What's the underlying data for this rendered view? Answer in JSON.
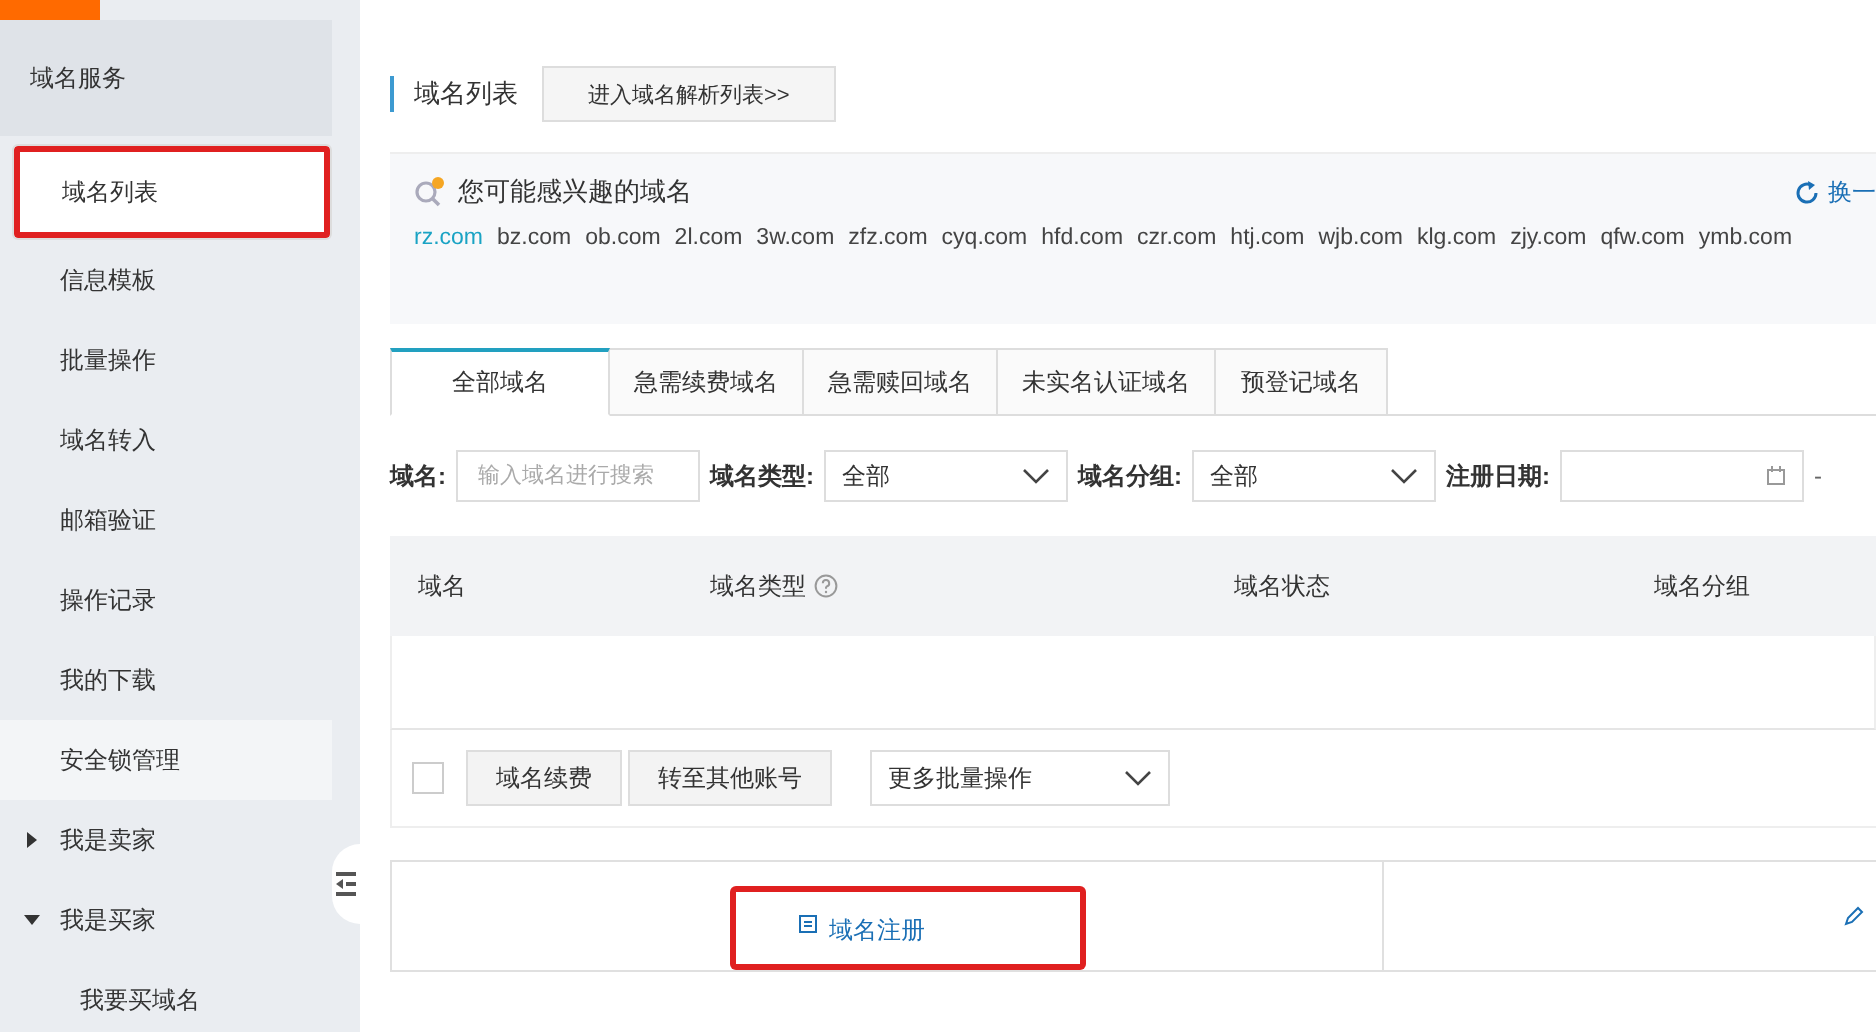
{
  "sidebar": {
    "title": "域名服务",
    "items": [
      {
        "label": "域名列表",
        "kind": "item",
        "selected": true,
        "highlighted": true
      },
      {
        "label": "信息模板",
        "kind": "item",
        "selected": false,
        "highlighted": false
      },
      {
        "label": "批量操作",
        "kind": "item",
        "selected": false,
        "highlighted": false
      },
      {
        "label": "域名转入",
        "kind": "item",
        "selected": false,
        "highlighted": false
      },
      {
        "label": "邮箱验证",
        "kind": "item",
        "selected": false,
        "highlighted": false
      },
      {
        "label": "操作记录",
        "kind": "item",
        "selected": false,
        "highlighted": false
      },
      {
        "label": "我的下载",
        "kind": "item",
        "selected": false,
        "highlighted": false
      },
      {
        "label": "安全锁管理",
        "kind": "item",
        "selected": false,
        "hovered": true,
        "highlighted": false
      },
      {
        "label": "我是卖家",
        "kind": "group",
        "expanded": false,
        "selected": false,
        "highlighted": false
      },
      {
        "label": "我是买家",
        "kind": "group",
        "expanded": true,
        "selected": false,
        "highlighted": false
      },
      {
        "label": "我要买域名",
        "kind": "subitem",
        "selected": false,
        "highlighted": false
      }
    ]
  },
  "header": {
    "title": "域名列表",
    "button": "进入域名解析列表>>"
  },
  "suggestions": {
    "title": "您可能感兴趣的域名",
    "refresh": "换一",
    "domains": [
      {
        "name": "rz.com",
        "selected": true
      },
      {
        "name": "bz.com",
        "selected": false
      },
      {
        "name": "ob.com",
        "selected": false
      },
      {
        "name": "2l.com",
        "selected": false
      },
      {
        "name": "3w.com",
        "selected": false
      },
      {
        "name": "zfz.com",
        "selected": false
      },
      {
        "name": "cyq.com",
        "selected": false
      },
      {
        "name": "hfd.com",
        "selected": false
      },
      {
        "name": "czr.com",
        "selected": false
      },
      {
        "name": "htj.com",
        "selected": false
      },
      {
        "name": "wjb.com",
        "selected": false
      },
      {
        "name": "klg.com",
        "selected": false
      },
      {
        "name": "zjy.com",
        "selected": false
      },
      {
        "name": "qfw.com",
        "selected": false
      },
      {
        "name": "ymb.com",
        "selected": false
      }
    ]
  },
  "tabs": [
    {
      "label": "全部域名",
      "selected": true
    },
    {
      "label": "急需续费域名",
      "selected": false
    },
    {
      "label": "急需赎回域名",
      "selected": false
    },
    {
      "label": "未实名认证域名",
      "selected": false
    },
    {
      "label": "预登记域名",
      "selected": false
    }
  ],
  "filters": {
    "name_label": "域名:",
    "name_placeholder": "输入域名进行搜索",
    "type_label": "域名类型:",
    "type_value": "全部",
    "group_label": "域名分组:",
    "group_value": "全部",
    "date_label": "注册日期:",
    "separator": "-"
  },
  "table": {
    "columns": [
      {
        "label": "域名",
        "help": false
      },
      {
        "label": "域名类型",
        "help": true
      },
      {
        "label": "域名状态",
        "help": false
      },
      {
        "label": "域名分组",
        "help": false
      }
    ]
  },
  "bulk": {
    "checked": false,
    "buttons": [
      "域名续费",
      "转至其他账号"
    ],
    "more": "更多批量操作"
  },
  "actions": [
    {
      "label": "域名注册",
      "highlighted": true
    },
    {
      "highlighted": false
    }
  ]
}
